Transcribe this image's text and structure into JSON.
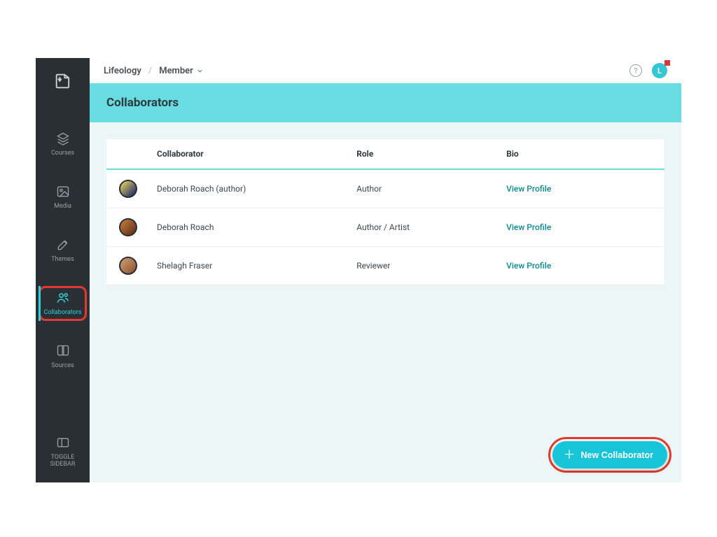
{
  "breadcrumbs": {
    "root": "Lifeology",
    "current": "Member"
  },
  "avatar_letter": "L",
  "page_title": "Collaborators",
  "sidebar": {
    "items": [
      {
        "label": "Courses",
        "icon": "layers"
      },
      {
        "label": "Media",
        "icon": "image"
      },
      {
        "label": "Themes",
        "icon": "palette"
      },
      {
        "label": "Collaborators",
        "icon": "users"
      },
      {
        "label": "Sources",
        "icon": "book"
      }
    ],
    "toggle_label": "TOGGLE\nSIDEBAR"
  },
  "table": {
    "headers": {
      "collaborator": "Collaborator",
      "role": "Role",
      "bio": "Bio"
    },
    "rows": [
      {
        "name": "Deborah Roach (author)",
        "role": "Author",
        "link": "View Profile"
      },
      {
        "name": "Deborah Roach",
        "role": "Author / Artist",
        "link": "View Profile"
      },
      {
        "name": "Shelagh Fraser",
        "role": "Reviewer",
        "link": "View Profile"
      }
    ]
  },
  "fab_label": "New Collaborator"
}
